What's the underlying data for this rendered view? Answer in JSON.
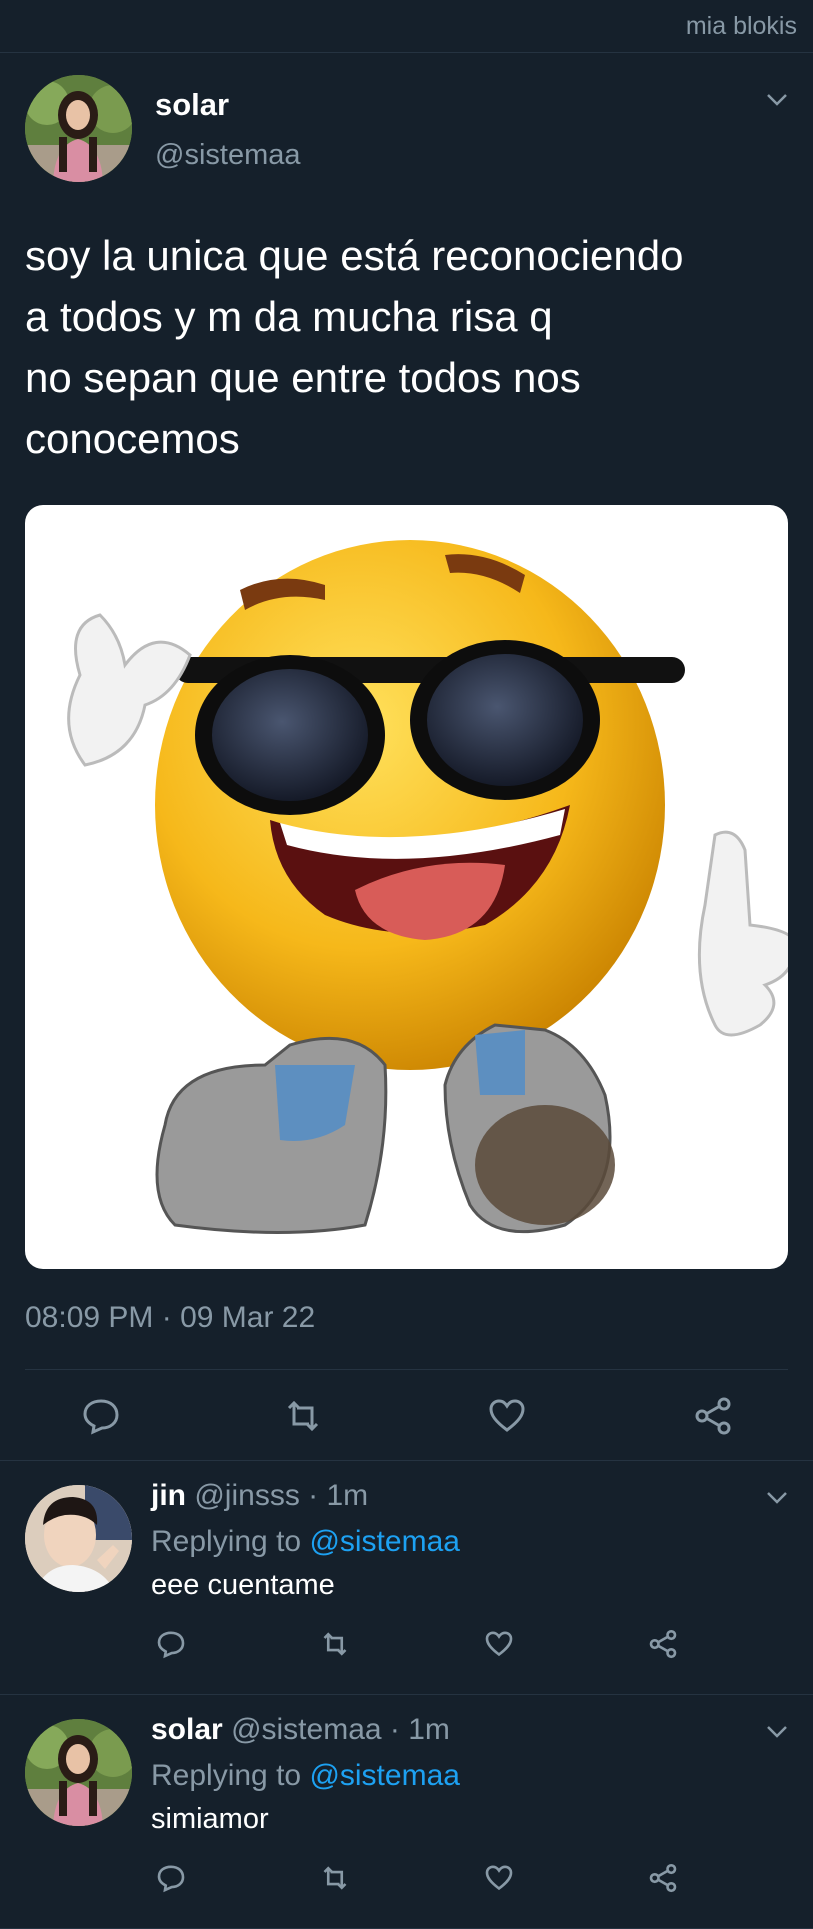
{
  "watermark": "mia blokis",
  "tweet": {
    "name": "solar",
    "handle": "@sistemaa",
    "text": "soy la unica que está reconociendo\na todos y m da mucha risa q\nno sepan que entre todos nos\nconocemos",
    "meta": "08:09 PM · 09 Mar 22"
  },
  "replies": [
    {
      "name": "jin",
      "handle": "@jinsss",
      "time": "1m",
      "replying_prefix": "Replying to ",
      "replying_to": "@sistemaa",
      "body": "eee cuentame"
    },
    {
      "name": "solar",
      "handle": "@sistemaa",
      "time": "1m",
      "replying_prefix": "Replying to ",
      "replying_to": "@sistemaa",
      "body": "simiamor"
    }
  ],
  "colors": {
    "background": "#15202b",
    "muted": "#8899a6",
    "link": "#1da1f2"
  },
  "icons": [
    "reply-icon",
    "retweet-icon",
    "like-icon",
    "share-icon",
    "chevron-down-icon"
  ]
}
